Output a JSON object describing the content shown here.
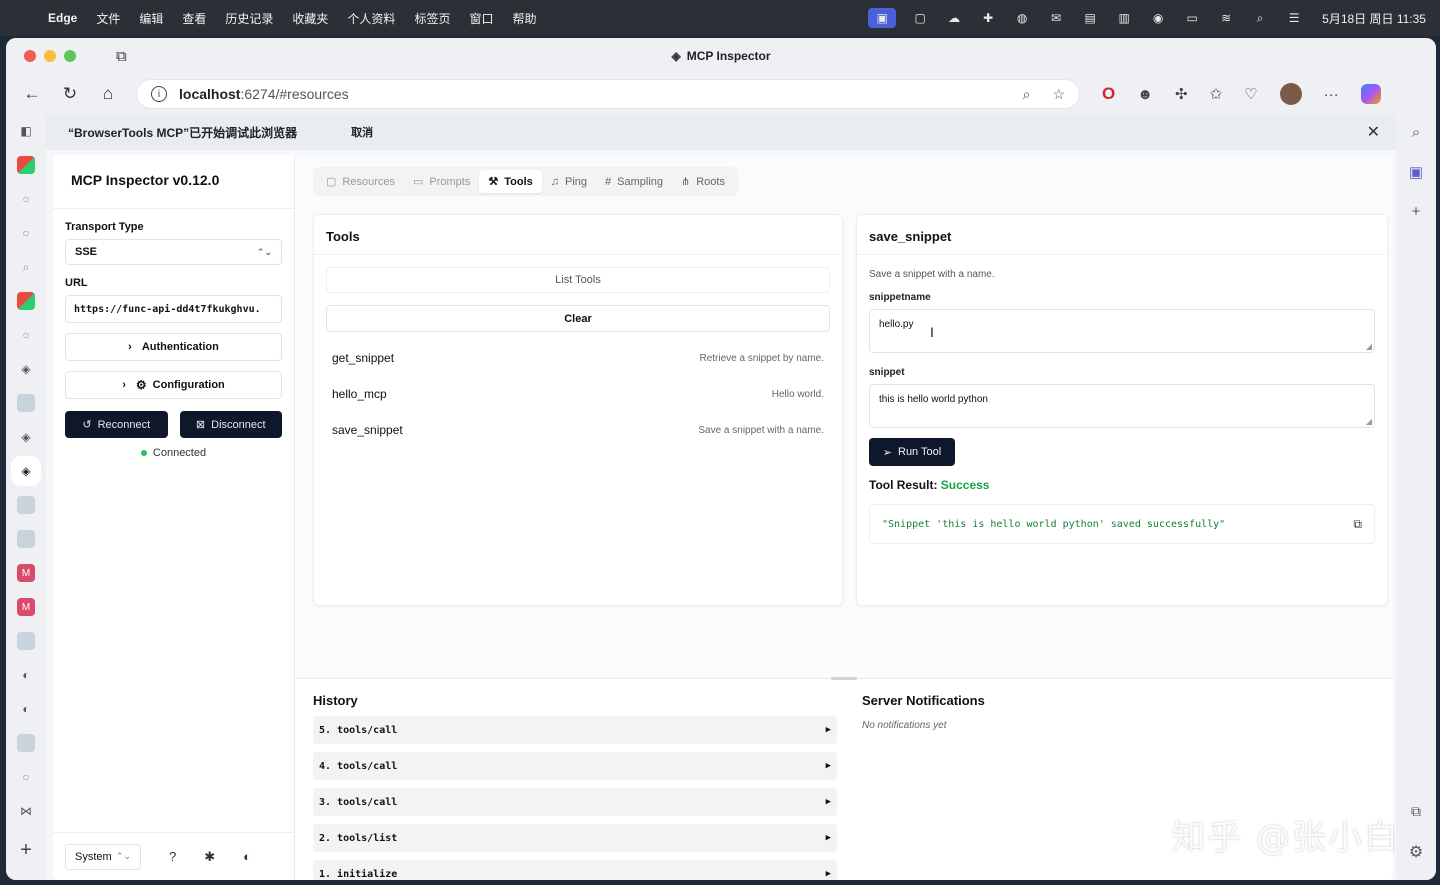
{
  "menubar": {
    "app": "Edge",
    "items": [
      "文件",
      "编辑",
      "查看",
      "历史记录",
      "收藏夹",
      "个人资料",
      "标签页",
      "窗口",
      "帮助"
    ],
    "clock": "5月18日 周日 11:35"
  },
  "window": {
    "title": "MCP Inspector"
  },
  "address": {
    "host": "localhost",
    "rest": ":6274/#resources"
  },
  "infobar": {
    "message": "“BrowserTools MCP”已开始调试此浏览器",
    "cancel": "取消"
  },
  "sidebar": {
    "title": "MCP Inspector v0.12.0",
    "transport_label": "Transport Type",
    "transport_value": "SSE",
    "url_label": "URL",
    "url_value": "https://func-api-dd4t7fkukghvu.",
    "auth_label": "Authentication",
    "config_label": "Configuration",
    "reconnect": "Reconnect",
    "disconnect": "Disconnect",
    "status": "Connected",
    "theme": "System"
  },
  "tabs": [
    "Resources",
    "Prompts",
    "Tools",
    "Ping",
    "Sampling",
    "Roots"
  ],
  "tools": {
    "title": "Tools",
    "list_button": "List Tools",
    "clear_button": "Clear",
    "items": [
      {
        "name": "get_snippet",
        "desc": "Retrieve a snippet by name."
      },
      {
        "name": "hello_mcp",
        "desc": "Hello world."
      },
      {
        "name": "save_snippet",
        "desc": "Save a snippet with a name."
      }
    ]
  },
  "detail": {
    "title": "save_snippet",
    "desc": "Save a snippet with a name.",
    "field1_label": "snippetname",
    "field1_value": "hello.py",
    "field2_label": "snippet",
    "field2_value": "this is hello world python",
    "run_button": "Run Tool",
    "result_label": "Tool Result:",
    "result_status": "Success",
    "result_text": "\"Snippet 'this is hello world python' saved successfully\""
  },
  "history": {
    "title": "History",
    "items": [
      "5. tools/call",
      "4. tools/call",
      "3. tools/call",
      "2. tools/list",
      "1. initialize"
    ]
  },
  "notifications": {
    "title": "Server Notifications",
    "empty": "No notifications yet"
  },
  "watermark": "知乎 @张小白",
  "colors": {
    "accent_dark": "#0f172a",
    "success": "#16a34a",
    "connected": "#22c55e"
  }
}
